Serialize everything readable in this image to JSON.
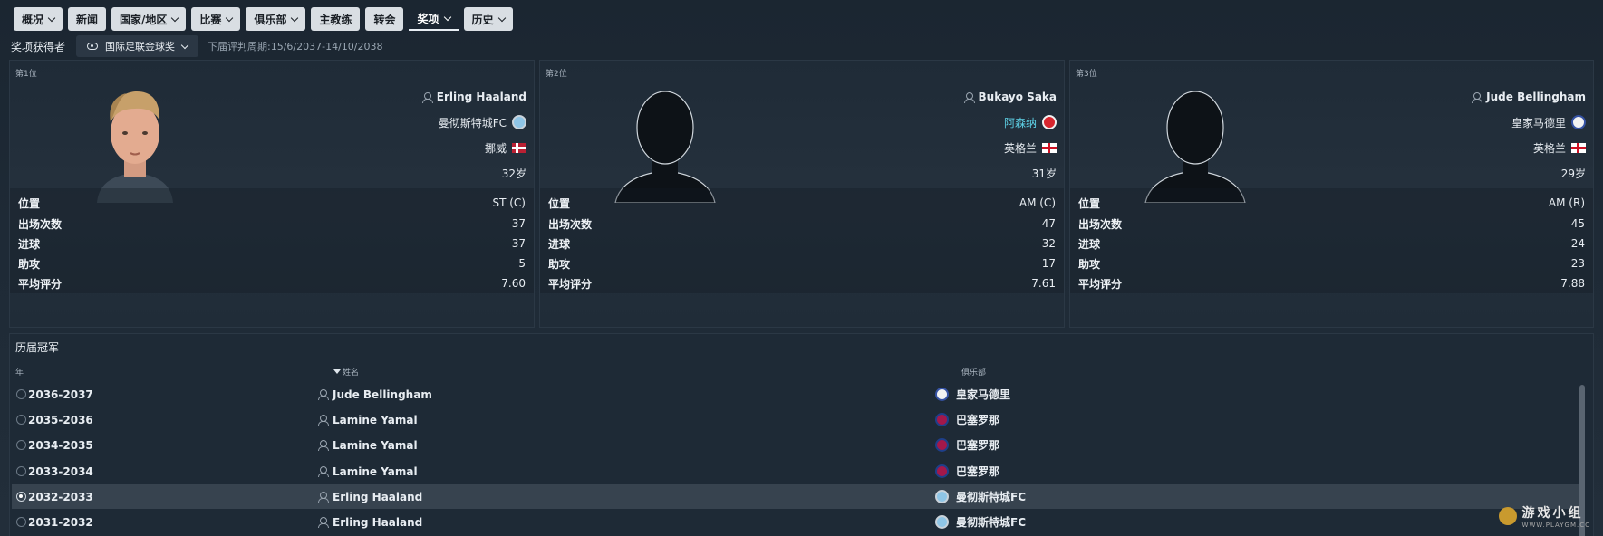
{
  "tabs": [
    {
      "label": "概况",
      "dropdown": true
    },
    {
      "label": "新闻",
      "dropdown": false
    },
    {
      "label": "国家/地区",
      "dropdown": true
    },
    {
      "label": "比赛",
      "dropdown": true
    },
    {
      "label": "俱乐部",
      "dropdown": true
    },
    {
      "label": "主教练",
      "dropdown": false
    },
    {
      "label": "转会",
      "dropdown": false
    },
    {
      "label": "奖项",
      "dropdown": true,
      "active": true
    },
    {
      "label": "历史",
      "dropdown": true
    }
  ],
  "subhead": {
    "label": "奖项获得者",
    "award_select": "国际足联金球奖",
    "period": "下届评判周期:15/6/2037-14/10/2038"
  },
  "winners": [
    {
      "rank": "第1位",
      "name": "Erling Haaland",
      "club": "曼彻斯特城FC",
      "club_crest": "city",
      "nation": "挪威",
      "flag": "norway",
      "age": "32岁",
      "stats": [
        {
          "k": "位置",
          "v": "ST (C)"
        },
        {
          "k": "出场次数",
          "v": "37"
        },
        {
          "k": "进球",
          "v": "37"
        },
        {
          "k": "助攻",
          "v": "5"
        },
        {
          "k": "平均评分",
          "v": "7.60"
        }
      ]
    },
    {
      "rank": "第2位",
      "name": "Bukayo Saka",
      "club": "阿森纳",
      "club_crest": "arsenal",
      "nation": "英格兰",
      "flag": "england",
      "age": "31岁",
      "stats": [
        {
          "k": "位置",
          "v": "AM (C)"
        },
        {
          "k": "出场次数",
          "v": "47"
        },
        {
          "k": "进球",
          "v": "32"
        },
        {
          "k": "助攻",
          "v": "17"
        },
        {
          "k": "平均评分",
          "v": "7.61"
        }
      ]
    },
    {
      "rank": "第3位",
      "name": "Jude Bellingham",
      "club": "皇家马德里",
      "club_crest": "madrid",
      "nation": "英格兰",
      "flag": "england",
      "age": "29岁",
      "stats": [
        {
          "k": "位置",
          "v": "AM (R)"
        },
        {
          "k": "出场次数",
          "v": "45"
        },
        {
          "k": "进球",
          "v": "24"
        },
        {
          "k": "助攻",
          "v": "23"
        },
        {
          "k": "平均评分",
          "v": "7.88"
        }
      ]
    }
  ],
  "history": {
    "title": "历届冠军",
    "columns": {
      "year": "年",
      "name": "姓名",
      "club": "俱乐部"
    },
    "rows": [
      {
        "year": "2036-2037",
        "name": "Jude Bellingham",
        "club": "皇家马德里",
        "crest": "madrid"
      },
      {
        "year": "2035-2036",
        "name": "Lamine Yamal",
        "club": "巴塞罗那",
        "crest": "barca"
      },
      {
        "year": "2034-2035",
        "name": "Lamine Yamal",
        "club": "巴塞罗那",
        "crest": "barca"
      },
      {
        "year": "2033-2034",
        "name": "Lamine Yamal",
        "club": "巴塞罗那",
        "crest": "barca"
      },
      {
        "year": "2032-2033",
        "name": "Erling Haaland",
        "club": "曼彻斯特城FC",
        "crest": "city",
        "selected": true
      },
      {
        "year": "2031-2032",
        "name": "Erling Haaland",
        "club": "曼彻斯特城FC",
        "crest": "city"
      }
    ]
  },
  "watermark": {
    "text": "游戏小组",
    "sub": "WWW.PLAYGM.CC"
  }
}
